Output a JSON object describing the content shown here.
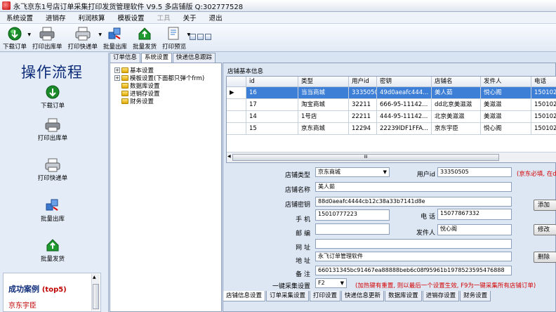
{
  "window": {
    "title": "永飞京东1号店订单采集打印发货管理软件 V9.5 多店铺版 Q:302777528"
  },
  "menu": {
    "items": [
      {
        "label": "系统设置",
        "disabled": false
      },
      {
        "label": "进销存",
        "disabled": false
      },
      {
        "label": "利润核算",
        "disabled": false
      },
      {
        "label": "模板设置",
        "disabled": false
      },
      {
        "label": "工具",
        "disabled": true
      },
      {
        "label": "关于",
        "disabled": false
      },
      {
        "label": "退出",
        "disabled": false
      }
    ]
  },
  "toolbar": {
    "download": "下载订单",
    "print_out": "打印出库单",
    "print_express": "打印快递单",
    "batch_out": "批量出库",
    "batch_ship": "批量发货",
    "print_preview": "打印预览"
  },
  "sidebar": {
    "title": "操作流程",
    "items": [
      "下载订单",
      "打印出库单",
      "打印快递单",
      "批量出库",
      "批量发货"
    ],
    "cases_title": "成功案例",
    "cases_badge": "(top5)",
    "cases": [
      "京东宇臣"
    ]
  },
  "top_tabs": [
    "订单信息",
    "系统设置",
    "快递信息跟踪"
  ],
  "tree": [
    {
      "label": "基本设置",
      "expander": "+"
    },
    {
      "label": "模板设置(下面都只弹个frm)",
      "expander": "+"
    },
    {
      "label": "数据库设置",
      "expander": ""
    },
    {
      "label": "进销存设置",
      "expander": ""
    },
    {
      "label": "财务设置",
      "expander": ""
    }
  ],
  "shop_group_title": "店铺基本信息",
  "grid": {
    "columns": [
      "id",
      "类型",
      "用户id",
      "密钥",
      "店铺名",
      "发件人",
      "电话"
    ],
    "rows": [
      [
        "16",
        "当当商城",
        "33350505",
        "49d0aeafc444...",
        "美人茹",
        "悦心阁",
        "15010267"
      ],
      [
        "17",
        "淘宝商城",
        "32211",
        "666-95-11142...",
        "dd北京美滋滋",
        "美滋滋",
        "15010267"
      ],
      [
        "14",
        "1号店",
        "22211",
        "444-95-11142...",
        "北京美滋滋",
        "美滋滋",
        "15010267"
      ],
      [
        "15",
        "京东商城",
        "12294",
        "22239lDF1FFA...",
        "京东宇臣",
        "悦心阁",
        "15010267"
      ]
    ],
    "selected_row": 0,
    "scroll_mark": "III"
  },
  "form": {
    "shop_type_label": "店铺类型",
    "shop_type_value": "京东商城",
    "user_id_label": "用户id",
    "user_id_value": "33350505",
    "user_id_note": "(京东必填, 在d",
    "shop_name_label": "店铺名称",
    "shop_name_value": "美人茹",
    "secret_label": "店铺密钥",
    "secret_value": "88d0aeafc4444cb12c38a33b7141d8e",
    "mobile_label": "手  机",
    "mobile_value": "15010777223",
    "phone_label": "电  话",
    "phone_value": "15077867332",
    "zip_label": "邮  编",
    "zip_value": "",
    "sender_label": "发件人",
    "sender_value": "悦心阁",
    "website_label": "网  址",
    "website_value": "",
    "address_label": "地  址",
    "address_value": "永飞订单管理软件",
    "remark_label": "备  注",
    "remark_value": "660131345bc91467ea88888beb6c08f95961b1978523595476888",
    "hotkey_label": "一键采集设置",
    "hotkey_value": "F2",
    "hotkey_note": "(加热键有重置, 则以最后一个设置生效, F9为一键采集所有店铺订单)",
    "add_button": "添加",
    "modify_button": "修改",
    "delete_button": "删除"
  },
  "bottom_tabs": [
    "店铺信息设置",
    "订单采集设置",
    "打印设置",
    "快递信息更新",
    "数据库设置",
    "进销存设置",
    "财务设置"
  ]
}
